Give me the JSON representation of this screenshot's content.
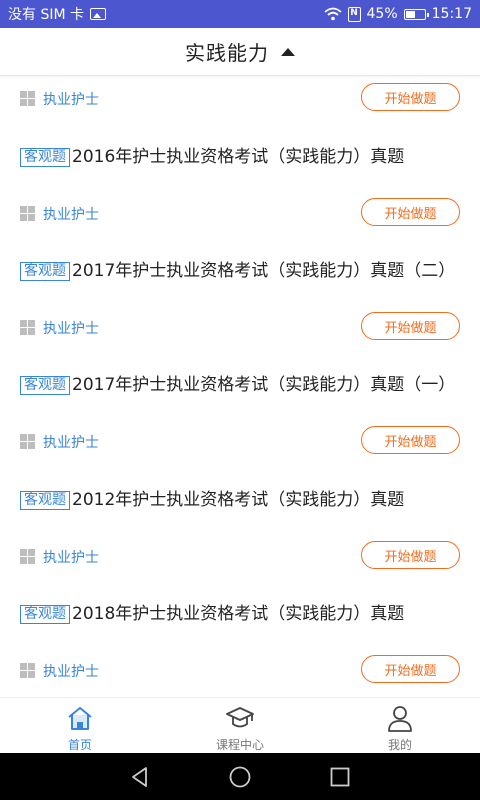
{
  "status_bar": {
    "carrier": "没有 SIM 卡",
    "battery": "45%",
    "time": "15:17"
  },
  "header": {
    "title": "实践能力"
  },
  "list": {
    "partial_item": {
      "category": "执业护士",
      "button": "开始做题"
    },
    "items": [
      {
        "tag": "客观题",
        "title": "2016年护士执业资格考试（实践能力）真题",
        "category": "执业护士",
        "button": "开始做题"
      },
      {
        "tag": "客观题",
        "title": "2017年护士执业资格考试（实践能力）真题（二）",
        "category": "执业护士",
        "button": "开始做题"
      },
      {
        "tag": "客观题",
        "title": "2017年护士执业资格考试（实践能力）真题（一）",
        "category": "执业护士",
        "button": "开始做题"
      },
      {
        "tag": "客观题",
        "title": "2012年护士执业资格考试（实践能力）真题",
        "category": "执业护士",
        "button": "开始做题"
      },
      {
        "tag": "客观题",
        "title": "2018年护士执业资格考试（实践能力）真题",
        "category": "执业护士",
        "button": "开始做题"
      }
    ]
  },
  "bottom_nav": [
    {
      "label": "首页",
      "icon": "home-icon",
      "active": true
    },
    {
      "label": "课程中心",
      "icon": "graduation-cap-icon",
      "active": false
    },
    {
      "label": "我的",
      "icon": "user-icon",
      "active": false
    }
  ],
  "colors": {
    "status_bar": "#4c57cf",
    "accent_blue": "#3a86d6",
    "accent_orange": "#f06d1f"
  }
}
